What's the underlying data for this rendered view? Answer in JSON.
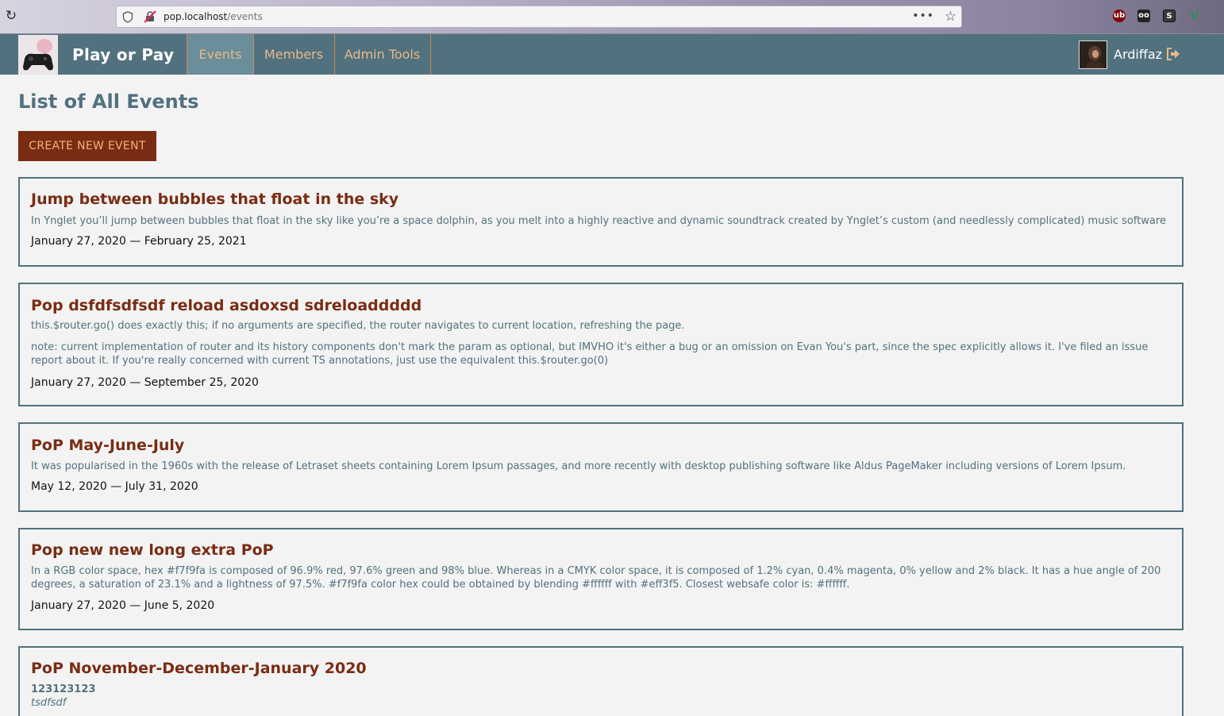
{
  "browser": {
    "url_host": "pop.localhost",
    "url_path": "/events"
  },
  "nav": {
    "brand": "Play or Pay",
    "items": [
      {
        "label": "Events",
        "active": true
      },
      {
        "label": "Members",
        "active": false
      },
      {
        "label": "Admin Tools",
        "active": false
      }
    ],
    "user_name": "Ardiffaz"
  },
  "main": {
    "title": "List of All Events",
    "create_label": "CREATE NEW EVENT",
    "events": [
      {
        "title": "Jump between bubbles that float in the sky",
        "desc": [
          "In Ynglet you’ll jump between bubbles that float in the sky like you’re a space dolphin, as you melt into a highly reactive and dynamic soundtrack created by Ynglet’s custom (and needlessly complicated) music software"
        ],
        "dates": "January 27, 2020 — February 25, 2021"
      },
      {
        "title": "Pop dsfdfsdfsdf reload asdoxsd sdreloaddddd",
        "desc": [
          "this.$router.go() does exactly this; if no arguments are specified, the router navigates to current location, refreshing the page.",
          "note: current implementation of router and its history components don't mark the param as optional, but IMVHO it's either a bug or an omission on Evan You's part, since the spec explicitly allows it. I've filed an issue report about it. If you're really concerned with current TS annotations, just use the equivalent this.$router.go(0)"
        ],
        "dates": "January 27, 2020 — September 25, 2020"
      },
      {
        "title": "PoP May-June-July",
        "desc": [
          "It was popularised in the 1960s with the release of Letraset sheets containing Lorem Ipsum passages, and more recently with desktop publishing software like Aldus PageMaker including versions of Lorem Ipsum."
        ],
        "dates": "May 12, 2020 — July 31, 2020"
      },
      {
        "title": "Pop new new long extra PoP",
        "desc": [
          "In a RGB color space, hex #f7f9fa is composed of 96.9% red, 97.6% green and 98% blue. Whereas in a CMYK color space, it is composed of 1.2% cyan, 0.4% magenta, 0% yellow and 2% black. It has a hue angle of 200 degrees, a saturation of 23.1% and a lightness of 97.5%. #f7f9fa color hex could be obtained by blending #ffffff with #eff3f5. Closest websafe color is: #ffffff."
        ],
        "dates": "January 27, 2020 — June 5, 2020"
      },
      {
        "title": "PoP November-December-January 2020",
        "bold_line": "123123123",
        "italic_line": "tsdfsdf"
      }
    ]
  },
  "colors": {
    "nav_bg": "#51717e",
    "accent": "#7a2c13",
    "nav_text": "#e6b98a",
    "page_bg": "#f3f3f3"
  },
  "icons": [
    "reload-icon",
    "shield-icon",
    "insecure-lock-icon",
    "page-actions-icon",
    "bookmark-star-icon",
    "ublock-icon",
    "ghostery-icon",
    "s-extension-icon",
    "vue-devtools-icon",
    "logout-icon"
  ]
}
